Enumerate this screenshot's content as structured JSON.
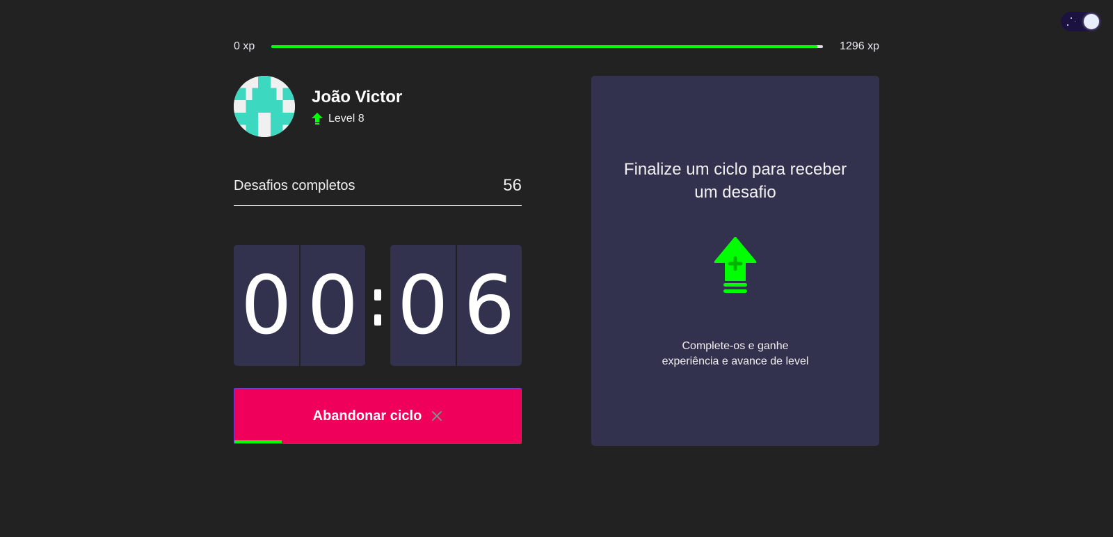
{
  "theme_toggle": {
    "icon": "moon-stars-toggle",
    "state": "dark"
  },
  "experience": {
    "min_label": "0 xp",
    "max_label": "1296 xp",
    "progress_fraction": 0.99,
    "accent_color": "#00ff00"
  },
  "profile": {
    "name": "João Victor",
    "level_label": "Level 8",
    "avatar_icon": "identicon-avatar",
    "level_icon": "level-up-arrow-icon"
  },
  "stats": {
    "completed_label": "Desafios completos",
    "completed_value": "56"
  },
  "countdown": {
    "minutes": [
      "0",
      "0"
    ],
    "seconds": [
      "0",
      "6"
    ]
  },
  "cycle": {
    "abandon_label": "Abandonar ciclo",
    "progress_fraction": 0.165
  },
  "challenge": {
    "title": "Finalize um ciclo para receber um desafio",
    "description_line1": "Complete-os e ganhe",
    "description_line2": "experiência e avance de level",
    "icon": "level-up-icon"
  },
  "colors": {
    "background": "#222222",
    "card": "#32324e",
    "abandon_button": "#ee005b",
    "accent_green": "#00ff00",
    "avatar_pattern": "#3cd9c0"
  }
}
